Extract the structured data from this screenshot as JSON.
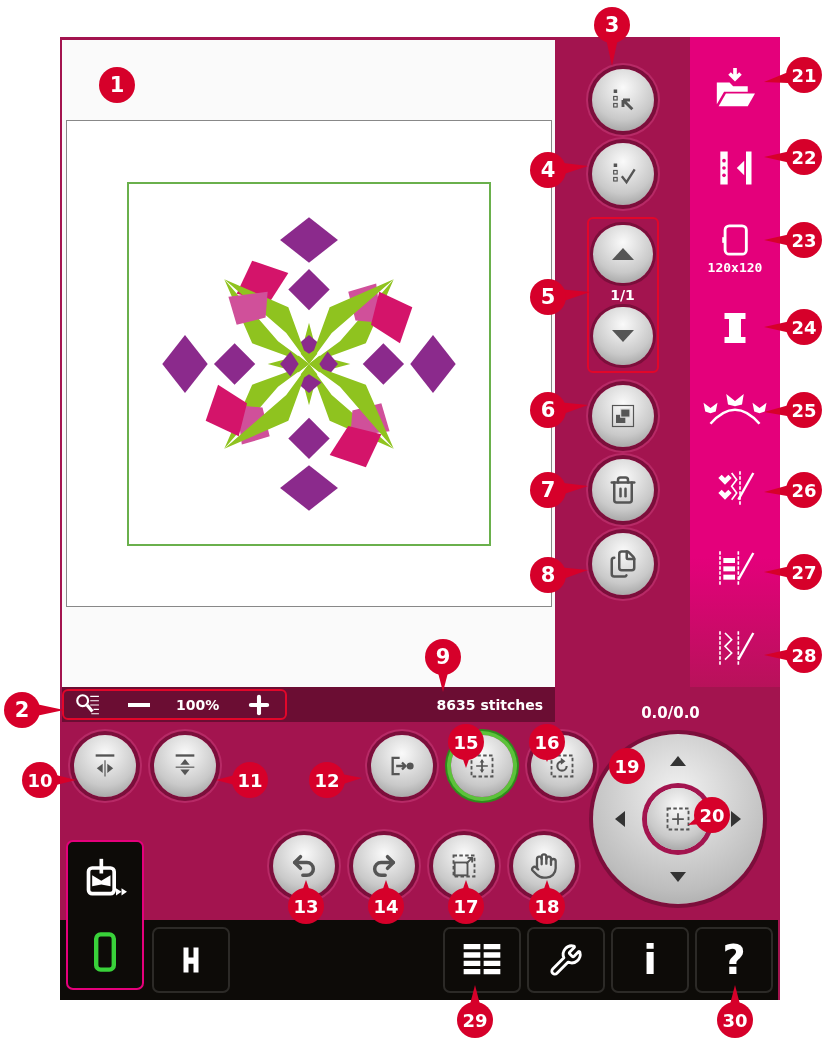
{
  "canvas": {
    "zoom": "100%",
    "stitch_count": "8635 stitches"
  },
  "page_scroll": {
    "indicator": "1/1"
  },
  "edit_row": [
    {
      "selected": false
    },
    {
      "selected": true
    },
    {
      "selected": false
    }
  ],
  "position": {
    "reading": "0.0/0.0"
  },
  "hoop": {
    "size": "120x120"
  },
  "bottom_bar": {
    "info": "i",
    "help": "?"
  },
  "callouts": [
    {
      "number": "1"
    },
    {
      "number": "2"
    },
    {
      "number": "3"
    },
    {
      "number": "4"
    },
    {
      "number": "5"
    },
    {
      "number": "6"
    },
    {
      "number": "7"
    },
    {
      "number": "8"
    },
    {
      "number": "9"
    },
    {
      "number": "10"
    },
    {
      "number": "11"
    },
    {
      "number": "12"
    },
    {
      "number": "13"
    },
    {
      "number": "14"
    },
    {
      "number": "15"
    },
    {
      "number": "16"
    },
    {
      "number": "17"
    },
    {
      "number": "18"
    },
    {
      "number": "19"
    },
    {
      "number": "20"
    },
    {
      "number": "21"
    },
    {
      "number": "22"
    },
    {
      "number": "23"
    },
    {
      "number": "24"
    },
    {
      "number": "25"
    },
    {
      "number": "26"
    },
    {
      "number": "27"
    },
    {
      "number": "28"
    },
    {
      "number": "29"
    },
    {
      "number": "30"
    }
  ]
}
